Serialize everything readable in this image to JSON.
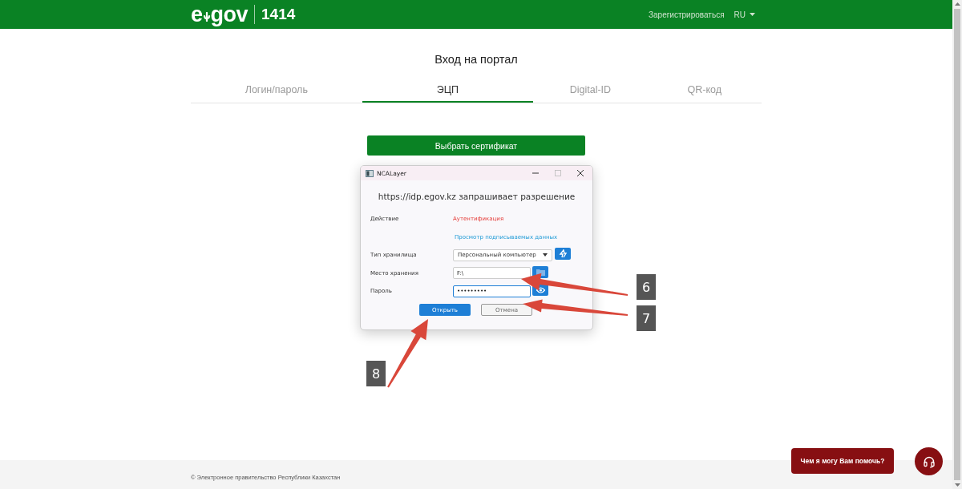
{
  "header": {
    "logo": {
      "prefix": "e",
      "suffix": "gov",
      "number": "1414"
    },
    "register_link": "Зарегистрироваться",
    "language": "RU"
  },
  "page_title": "Вход на портал",
  "tabs": [
    {
      "label": "Логин/пароль",
      "selected": false
    },
    {
      "label": "ЭЦП",
      "selected": true
    },
    {
      "label": "Digital-ID",
      "selected": false
    },
    {
      "label": "QR-код",
      "selected": false
    }
  ],
  "select_certificate_button": "Выбрать сертификат",
  "dialog": {
    "title": "NCALayer",
    "heading": "https://idp.egov.kz запрашивает разрешение",
    "action_label": "Действие",
    "action_value": "Аутентификация",
    "view_data_link": "Просмотр подписываемых данных",
    "storage_type_label": "Тип хранилища",
    "storage_type_value": "Персональный компьютер",
    "storage_location_label": "Место хранения",
    "storage_location_value": "F:\\",
    "password_label": "Пароль",
    "password_value": "•••••••••",
    "open_button": "Открыть",
    "cancel_button": "Отмена"
  },
  "annotations": [
    {
      "label": "6"
    },
    {
      "label": "7"
    },
    {
      "label": "8"
    }
  ],
  "footer": {
    "copyright": "© Электронное правительство Республики Казахстан"
  },
  "chat": {
    "prompt": "Чем я могу Вам помочь?"
  }
}
